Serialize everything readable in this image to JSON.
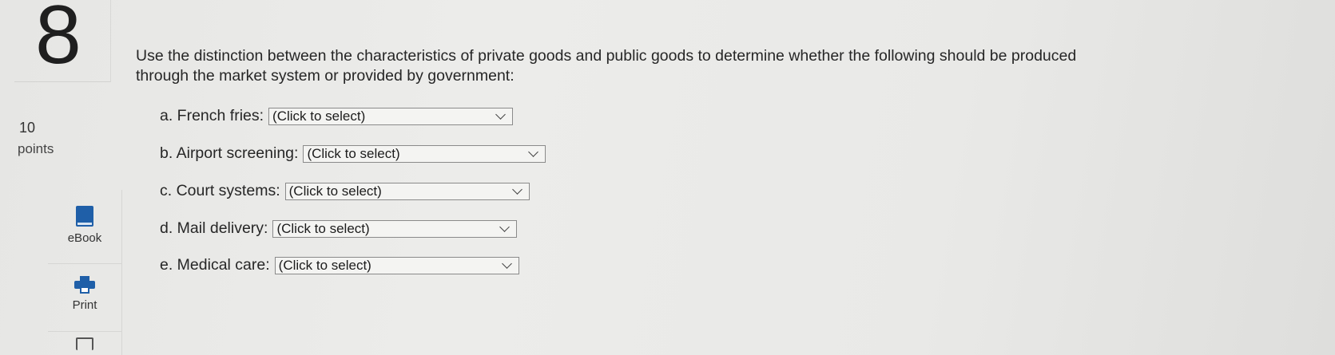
{
  "question": {
    "number": "8",
    "points_value": "10",
    "points_label": "points",
    "prompt": "Use the distinction between the characteristics of private goods and public goods to determine whether the following should be produced through the market system or provided by government:"
  },
  "tools": {
    "ebook_label": "eBook",
    "print_label": "Print",
    "icons": [
      "book-icon",
      "printer-icon",
      "copy-icon"
    ]
  },
  "items": [
    {
      "label": "a. French fries:",
      "selected": "(Click to select)"
    },
    {
      "label": "b. Airport screening:",
      "selected": "(Click to select)"
    },
    {
      "label": "c. Court systems:",
      "selected": "(Click to select)"
    },
    {
      "label": "d. Mail delivery:",
      "selected": "(Click to select)"
    },
    {
      "label": "e. Medical care:",
      "selected": "(Click to select)"
    }
  ],
  "colors": {
    "accent": "#1f5fa8",
    "background": "#e9e9e7"
  }
}
